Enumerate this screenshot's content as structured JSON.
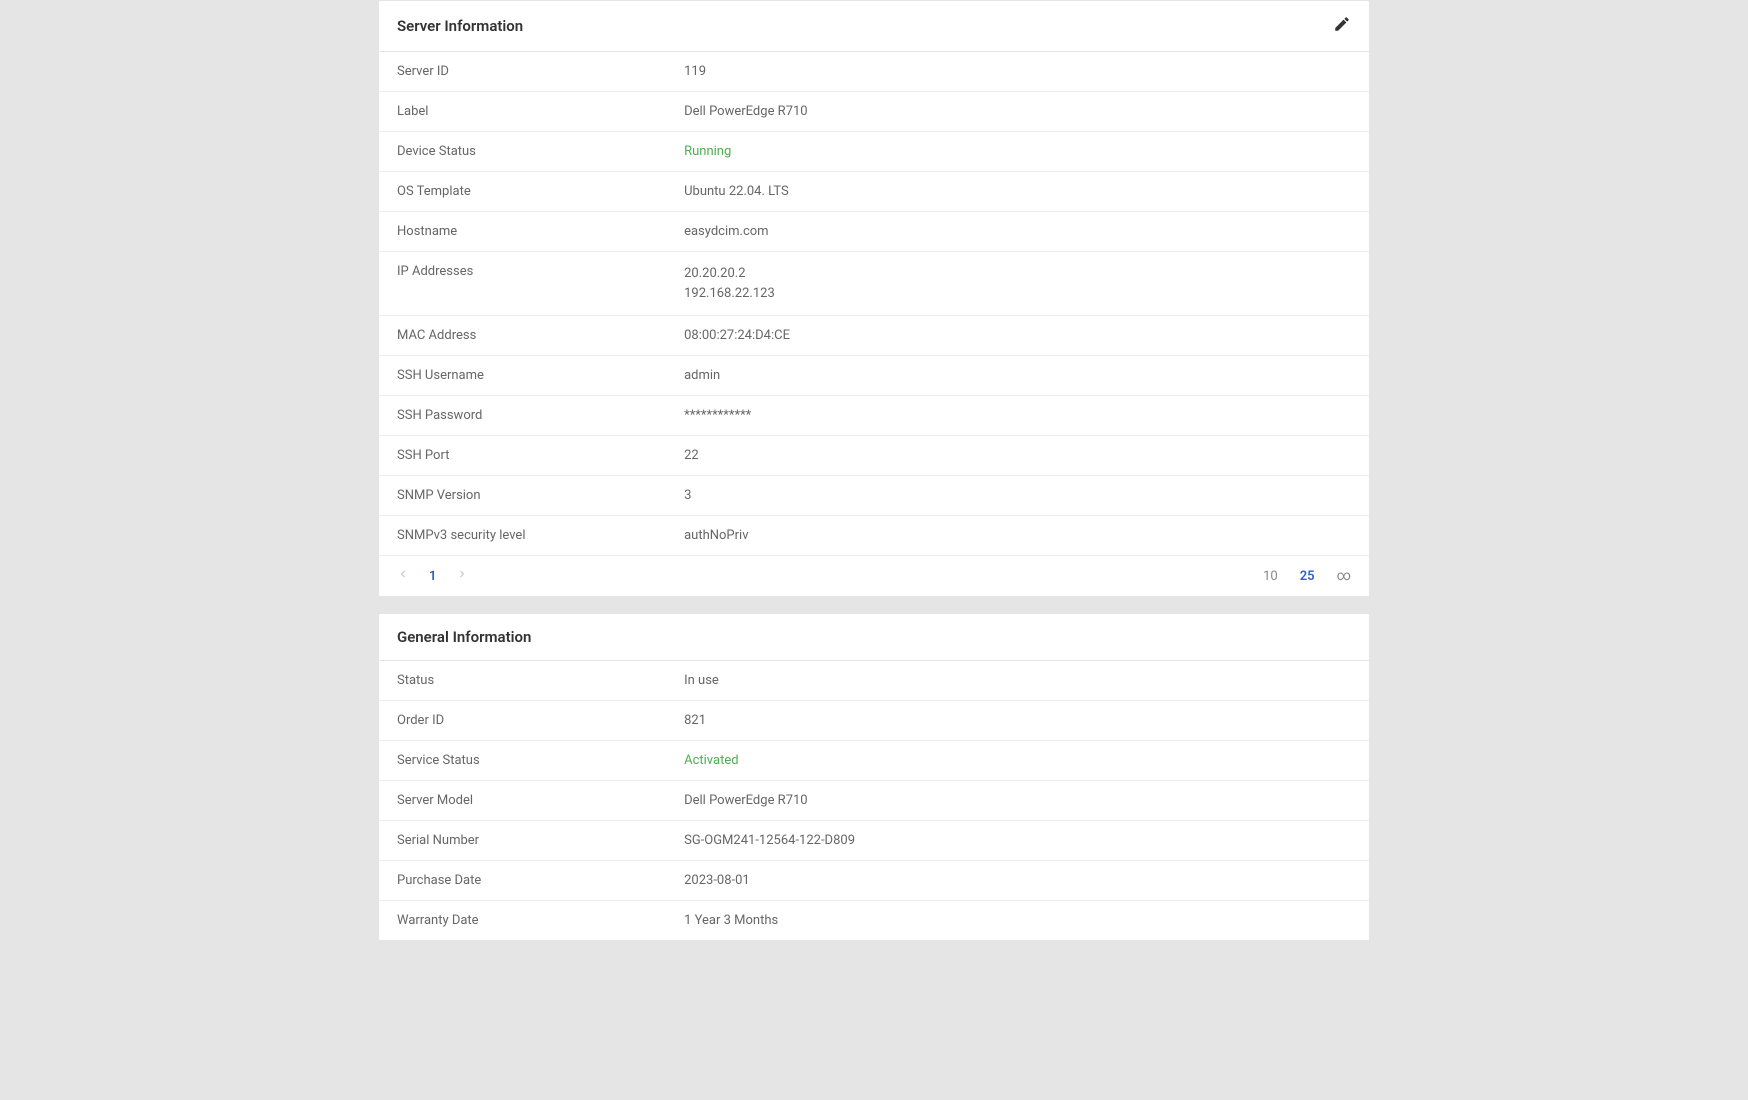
{
  "server_info": {
    "title": "Server Information",
    "rows": [
      {
        "label": "Server ID",
        "value": "119"
      },
      {
        "label": "Label",
        "value": "Dell PowerEdge R710"
      },
      {
        "label": "Device Status",
        "value": "Running",
        "status": "green"
      },
      {
        "label": "OS Template",
        "value": "Ubuntu 22.04. LTS"
      },
      {
        "label": "Hostname",
        "value": "easydcim.com"
      },
      {
        "label": "IP Addresses",
        "values": [
          "20.20.20.2",
          "192.168.22.123"
        ]
      },
      {
        "label": "MAC Address",
        "value": "08:00:27:24:D4:CE"
      },
      {
        "label": "SSH Username",
        "value": "admin"
      },
      {
        "label": "SSH Password",
        "value": "************"
      },
      {
        "label": "SSH Port",
        "value": "22"
      },
      {
        "label": "SNMP Version",
        "value": "3"
      },
      {
        "label": "SNMPv3 security level",
        "value": "authNoPriv"
      }
    ],
    "pagination": {
      "current_page": "1",
      "page_sizes": [
        "10",
        "25"
      ],
      "active_size": "25",
      "infinity": "∞"
    }
  },
  "general_info": {
    "title": "General Information",
    "rows": [
      {
        "label": "Status",
        "value": "In use"
      },
      {
        "label": "Order ID",
        "value": "821"
      },
      {
        "label": "Service Status",
        "value": "Activated",
        "status": "green"
      },
      {
        "label": "Server Model",
        "value": "Dell PowerEdge R710"
      },
      {
        "label": "Serial Number",
        "value": "SG-OGM241-12564-122-D809"
      },
      {
        "label": "Purchase Date",
        "value": "2023-08-01"
      },
      {
        "label": "Warranty Date",
        "value": "1 Year 3 Months"
      }
    ]
  }
}
